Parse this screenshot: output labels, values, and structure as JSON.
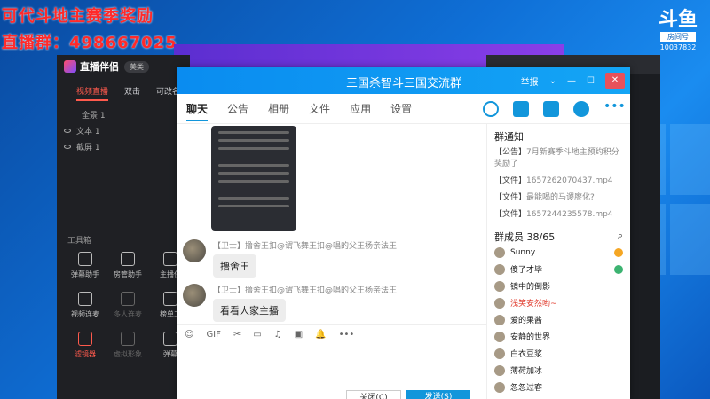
{
  "overlay": {
    "line1": "可代斗地主赛季奖励",
    "line2": "直播群：498667025"
  },
  "logo": {
    "mark": "斗鱼",
    "tag": "房间号",
    "room": "10037832"
  },
  "app": {
    "name": "直播伴侣",
    "pill": "美类",
    "tabs": [
      "视频直播",
      "双击",
      "可改名"
    ],
    "sources": [
      "全景 1",
      "文本 1",
      "截屏 1"
    ],
    "tools_title": "工具箱",
    "tools": [
      {
        "label": "弹幕助手",
        "style": "normal"
      },
      {
        "label": "房管助手",
        "style": "normal"
      },
      {
        "label": "主播任",
        "style": "normal"
      },
      {
        "label": "视频连麦",
        "style": "normal"
      },
      {
        "label": "多人连麦",
        "style": "dim"
      },
      {
        "label": "榜单工",
        "style": "normal"
      },
      {
        "label": "滤镜器",
        "style": "red"
      },
      {
        "label": "虚拟形象",
        "style": "dim"
      },
      {
        "label": "弹幕",
        "style": "normal"
      }
    ]
  },
  "qq": {
    "title": "三国杀智斗三国交流群",
    "title_right": [
      "举报",
      "⌄",
      "—",
      "☐"
    ],
    "close": "✕",
    "tabs": [
      "聊天",
      "公告",
      "相册",
      "文件",
      "应用",
      "设置"
    ],
    "messages": [
      {
        "sender": "【卫士】撸舍王扣@谓飞舞王扣@唱的父王杨亲法王",
        "text": "撸舍王"
      },
      {
        "sender": "【卫士】撸舍王扣@谓飞舞王扣@唱的父王杨亲法王",
        "text": "看看人家主播"
      }
    ],
    "toolbar": [
      "☺",
      "GIF",
      "✂",
      "▭",
      "♫",
      "▣",
      "🔔",
      "•••"
    ],
    "buttons": {
      "close": "关闭(C)",
      "send": "发送(S)"
    },
    "side": {
      "notice_title": "群通知",
      "notices": [
        {
          "tag": "【公告】",
          "text": "7月新赛季斗地主预约积分奖励了"
        },
        {
          "tag": "【文件】",
          "text": "1657262070437.mp4"
        },
        {
          "tag": "【文件】",
          "text": "最能喝的马谡廖化?"
        },
        {
          "tag": "【文件】",
          "text": "1657244235578.mp4"
        }
      ],
      "members_title": "群成员 38/65",
      "members": [
        {
          "name": "Sunny",
          "color": "#222"
        },
        {
          "name": "傻了才毕",
          "color": "#222"
        },
        {
          "name": "镜中的倒影",
          "color": "#222"
        },
        {
          "name": "浅笑安然哟~",
          "color": "#e0392b"
        },
        {
          "name": "爱的果酱",
          "color": "#222"
        },
        {
          "name": "安静的世界",
          "color": "#222"
        },
        {
          "name": "白衣豆浆",
          "color": "#222"
        },
        {
          "name": "薄荷加冰",
          "color": "#222"
        },
        {
          "name": "忽忽过客",
          "color": "#222"
        }
      ]
    }
  }
}
